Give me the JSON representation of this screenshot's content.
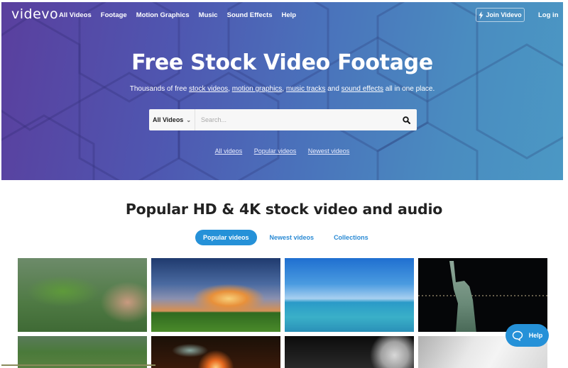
{
  "header": {
    "logo": "videvo",
    "nav": [
      "All Videos",
      "Footage",
      "Motion Graphics",
      "Music",
      "Sound Effects",
      "Help"
    ],
    "join_label": "Join Videvo",
    "join_icon": "lightning-bolt-icon",
    "login_label": "Log in"
  },
  "hero": {
    "title": "Free Stock Video Footage",
    "subtitle": {
      "prefix": "Thousands of free ",
      "link1": "stock videos",
      "sep1": ", ",
      "link2": "motion graphics",
      "sep2": ", ",
      "link3": "music tracks",
      "middle": " and ",
      "link4": "sound effects",
      "suffix": " all in one place."
    },
    "search": {
      "category": "All Videos",
      "placeholder": "Search...",
      "value": "",
      "button_icon": "search-icon"
    },
    "quick_links": [
      "All videos",
      "Popular videos",
      "Newest videos"
    ]
  },
  "main": {
    "section_title": "Popular HD & 4K stock video and audio",
    "tabs": [
      {
        "label": "Popular videos",
        "active": true
      },
      {
        "label": "Newest videos",
        "active": false
      },
      {
        "label": "Collections",
        "active": false
      }
    ],
    "thumbnails": [
      {
        "subject": "green leaves in rain"
      },
      {
        "subject": "dramatic clouds over field at sunset"
      },
      {
        "subject": "ocean waves under blue sky"
      },
      {
        "subject": "Statue of Liberty at night"
      },
      {
        "subject": "grass close-up"
      },
      {
        "subject": "sun rays through clouds"
      },
      {
        "subject": "moon in dark sky"
      },
      {
        "subject": "abstract gray gradient"
      }
    ]
  },
  "colors": {
    "accent": "#2591d8",
    "hero_start": "#5a3f9e",
    "hero_end": "#4b98c4",
    "heading": "#222222"
  },
  "help_widget": {
    "label": "Help",
    "icon": "chat-bubble-icon"
  }
}
